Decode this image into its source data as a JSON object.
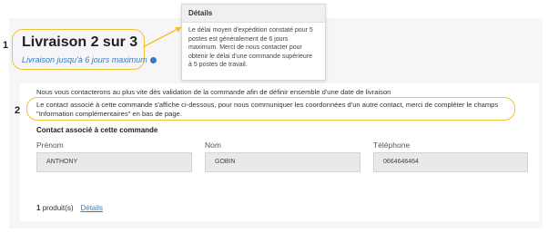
{
  "step": {
    "title": "Livraison 2 sur 3",
    "subtitle": "Livraison jusqu'à 6 jours maximum"
  },
  "tooltip": {
    "title": "Détails",
    "body": "Le délai moyen d'expédition constaté pour 5\npostes est généralement de 6 jours\nmaximum. Merci de nous contacter pour\nobtenir le délai d'une commande supérieure\nà 5 postes de travail."
  },
  "annotations": {
    "marker1": "1",
    "marker2": "2"
  },
  "main": {
    "intro": "Nous vous contacterons au plus vite dès validation de la commande afin de définir ensemble d'une date de livraison",
    "contact_line1": "Le contact associé à cette commande s'affiche ci-dessous, pour nous communiquer les coordonnées d'un autre contact, merci de compléter le champs",
    "contact_line2": "\"Information complémentaires\" en bas de page.",
    "contact_heading": "Contact associé à cette commande"
  },
  "fields": {
    "prenom": {
      "label": "Prénom",
      "value": "ANTHONY"
    },
    "nom": {
      "label": "Nom",
      "value": "GOBIN"
    },
    "telephone": {
      "label": "Téléphone",
      "value": "0664646464"
    }
  },
  "footer": {
    "count": "1",
    "count_label": "produit(s)",
    "details_link": "Détails"
  },
  "colors": {
    "highlight": "#f0c330",
    "link": "#3a7bbf",
    "panel_bg": "#f6f5f8"
  },
  "icons": {
    "info": "info-icon"
  }
}
